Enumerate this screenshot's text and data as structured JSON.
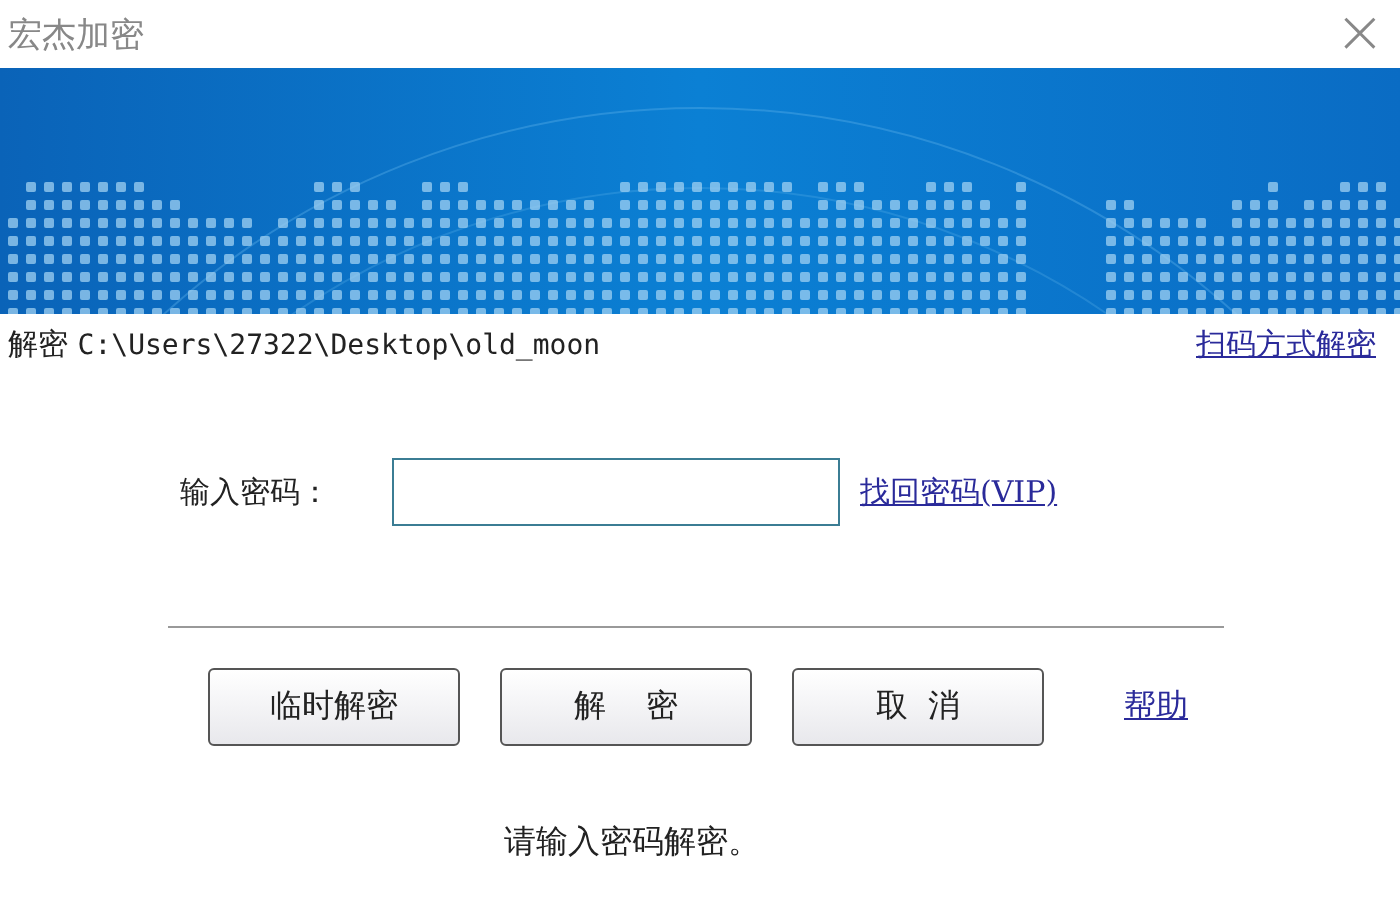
{
  "window": {
    "title": "宏杰加密",
    "close": "×"
  },
  "path": {
    "label": "解密",
    "value": "C:\\Users\\27322\\Desktop\\old_moon"
  },
  "scan_link": "扫码方式解密",
  "password": {
    "label": "输入密码："
  },
  "recover_link": "找回密码(VIP)",
  "buttons": [
    {
      "label": "临时解密"
    },
    {
      "label": "解    密"
    },
    {
      "label": "取  消"
    }
  ],
  "help_link": "帮助",
  "status": "请输入密码解密。"
}
